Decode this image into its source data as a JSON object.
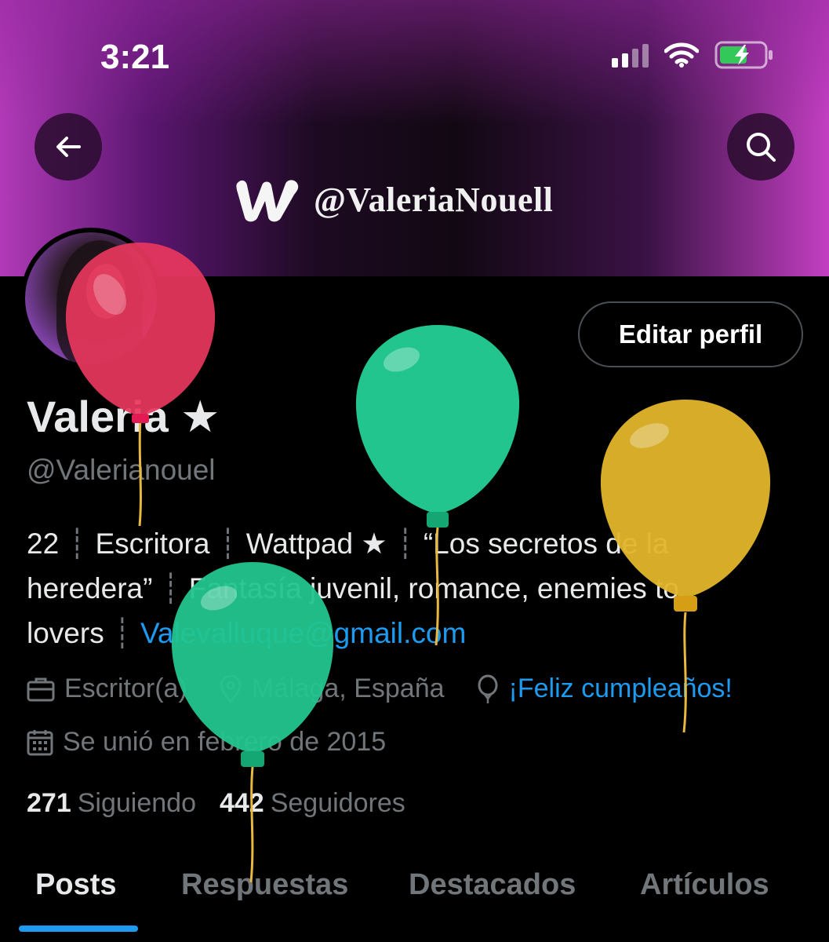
{
  "status_bar": {
    "time": "3:21"
  },
  "banner": {
    "handle": "@ValeriaNouell"
  },
  "profile": {
    "edit_button": "Editar perfil",
    "display_name": "Valeria ★",
    "username": "@Valerianouel",
    "bio": {
      "age": "22",
      "role": "Escritora",
      "platform": "Wattpad ★",
      "book": "“Los secretos de la heredera”",
      "genres": "Fantasía juvenil, romance, enemies to lovers",
      "email": "Valevalluque@gmail.com"
    },
    "meta": {
      "category": "Escritor(a)",
      "location": "Málaga, España",
      "birthday": "¡Feliz cumpleaños!",
      "joined": "Se unió en febrero de 2015"
    },
    "stats": {
      "following_count": "271",
      "following_label": "Siguiendo",
      "followers_count": "442",
      "followers_label": "Seguidores"
    }
  },
  "tabs": [
    {
      "label": "Posts",
      "active": true
    },
    {
      "label": "Respuestas"
    },
    {
      "label": "Destacados"
    },
    {
      "label": "Artículos"
    }
  ],
  "colors": {
    "accent": "#1d9bf0",
    "balloon_red": "#e8375d",
    "balloon_green": "#22c58e",
    "balloon_yellow": "#e2b52a"
  },
  "icons": [
    "back-arrow-icon",
    "search-icon",
    "signal-icon",
    "wifi-icon",
    "battery-charging-icon",
    "wattpad-logo",
    "briefcase-icon",
    "location-pin-icon",
    "balloon-icon",
    "calendar-icon"
  ]
}
